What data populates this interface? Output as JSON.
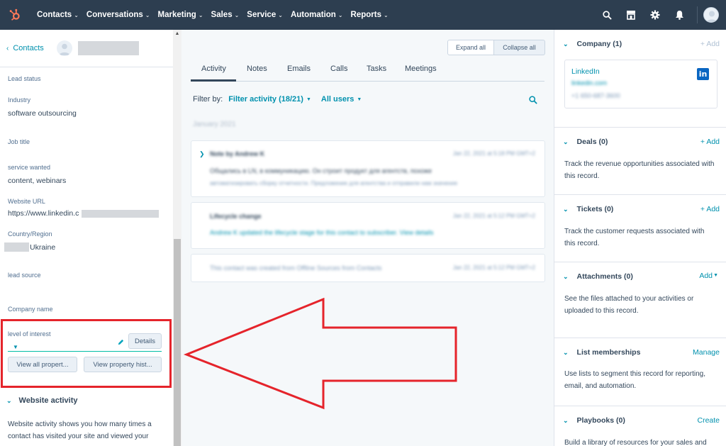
{
  "nav": {
    "items": [
      {
        "label": "Contacts"
      },
      {
        "label": "Conversations"
      },
      {
        "label": "Marketing"
      },
      {
        "label": "Sales"
      },
      {
        "label": "Service"
      },
      {
        "label": "Automation"
      },
      {
        "label": "Reports"
      }
    ],
    "icons": [
      "search-icon",
      "marketplace-icon",
      "settings-icon",
      "notifications-icon"
    ],
    "colors": {
      "background": "#2d3e50",
      "accent": "#ff7a59"
    }
  },
  "left": {
    "back_label": "Contacts",
    "properties": {
      "lead_status": {
        "label": "Lead status"
      },
      "industry": {
        "label": "Industry",
        "value": "software outsourcing"
      },
      "job_title": {
        "label": "Job title"
      },
      "service_wanted": {
        "label": "service wanted",
        "value": "content, webinars"
      },
      "website_url": {
        "label": "Website URL",
        "value": "https://www.linkedin.c"
      },
      "country": {
        "label": "Country/Region",
        "value": "Ukraine"
      },
      "lead_source": {
        "label": "lead source"
      },
      "company_name": {
        "label": "Company name"
      },
      "level_of_interest": {
        "label": "level of interest"
      }
    },
    "details_button": "Details",
    "view_all_button": "View all propert...",
    "view_history_button": "View property hist...",
    "website_activity": {
      "title": "Website activity",
      "text": "Website activity shows you how many times a contact has visited your site and viewed your"
    },
    "highlight_color": "#e5242b"
  },
  "middle": {
    "expand_all": "Expand all",
    "collapse_all": "Collapse all",
    "tabs": [
      {
        "label": "Activity"
      },
      {
        "label": "Notes"
      },
      {
        "label": "Emails"
      },
      {
        "label": "Calls"
      },
      {
        "label": "Tasks"
      },
      {
        "label": "Meetings"
      }
    ],
    "filter_label": "Filter by:",
    "filter_activity": "Filter activity (18/21)",
    "all_users": "All users",
    "month": "January 2021",
    "cards": [
      {
        "title": "Note by Andrew K",
        "date": "Jan 22, 2021 at 5:18 PM GMT+2",
        "line1": "Общались в LN, в коммуникацию. Он строит продукт для агентств, похоже",
        "line2": "автоматизировать сборку отчетности. Предложение для агентства и отправили нам значение"
      },
      {
        "title": "Lifecycle change",
        "date": "Jan 22, 2021 at 5:12 PM GMT+2",
        "line1": "Andrew K updated the lifecycle stage for this contact to subscriber. View details"
      },
      {
        "title": "This contact was created from Offline Sources from Contacts",
        "date": "Jan 22, 2021 at 5:12 PM GMT+2"
      }
    ]
  },
  "right": {
    "company": {
      "title": "Company (1)",
      "action": "+ Add",
      "name": "LinkedIn",
      "domain": "linkedin.com",
      "phone": "+1 650-687-3600"
    },
    "deals": {
      "title": "Deals (0)",
      "action": "+ Add",
      "text": "Track the revenue opportunities associated with this record."
    },
    "tickets": {
      "title": "Tickets (0)",
      "action": "+ Add",
      "text": "Track the customer requests associated with this record."
    },
    "attachments": {
      "title": "Attachments (0)",
      "action": "Add",
      "text": "See the files attached to your activities or uploaded to this record."
    },
    "lists": {
      "title": "List memberships",
      "action": "Manage",
      "text": "Use lists to segment this record for reporting, email, and automation."
    },
    "playbooks": {
      "title": "Playbooks (0)",
      "action": "Create",
      "text": "Build a library of resources for your sales and"
    }
  }
}
